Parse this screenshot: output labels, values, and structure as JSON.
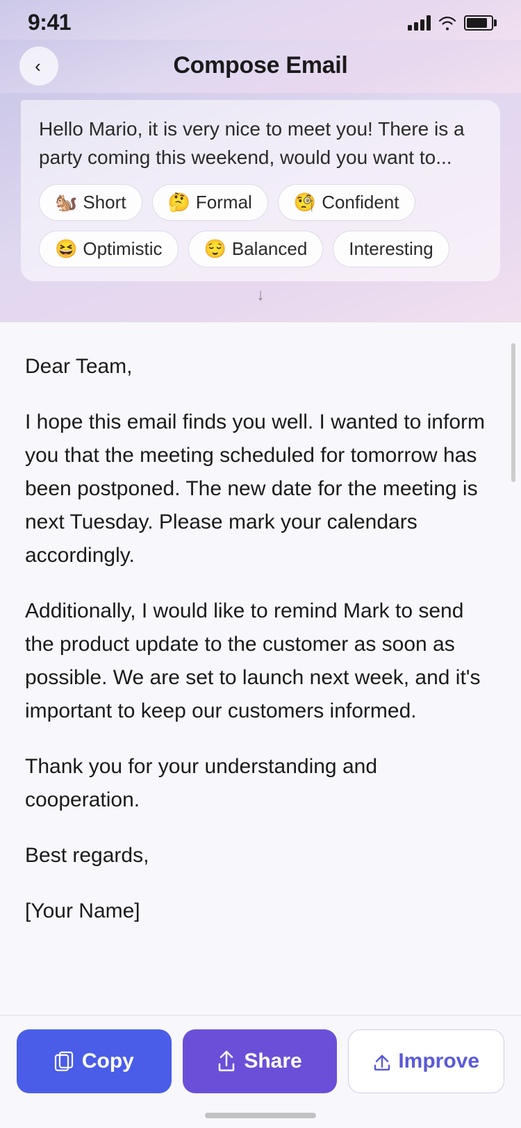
{
  "statusBar": {
    "time": "9:41",
    "signal": "signal-icon",
    "wifi": "wifi-icon",
    "battery": "battery-icon"
  },
  "header": {
    "title": "Compose Email",
    "backLabel": "<"
  },
  "suggestion": {
    "text": "Hello Mario, it is very nice to meet you! There is a party coming this weekend, would you want to...",
    "tones": [
      {
        "emoji": "🐿️",
        "label": "Short"
      },
      {
        "emoji": "🤔",
        "label": "Formal"
      },
      {
        "emoji": "🧐",
        "label": "Confident"
      },
      {
        "emoji": "😆",
        "label": "Optimistic"
      },
      {
        "emoji": "😌",
        "label": "Balanced"
      },
      {
        "emoji": "",
        "label": "Interesting"
      }
    ]
  },
  "email": {
    "salutation": "Dear Team,",
    "paragraph1": "I hope this email finds you well. I wanted to inform you that the meeting scheduled for tomorrow has been postponed. The new date for the meeting is next Tuesday. Please mark your calendars accordingly.",
    "paragraph2": "Additionally, I would like to remind Mark to send the product update to the customer as soon as possible. We are set to launch next week, and it's important to keep our customers informed.",
    "paragraph3": "Thank you for your understanding and cooperation.",
    "closing": "Best regards,",
    "signature": "[Your Name]"
  },
  "actions": {
    "copy": "Copy",
    "share": "Share",
    "improve": "Improve"
  }
}
